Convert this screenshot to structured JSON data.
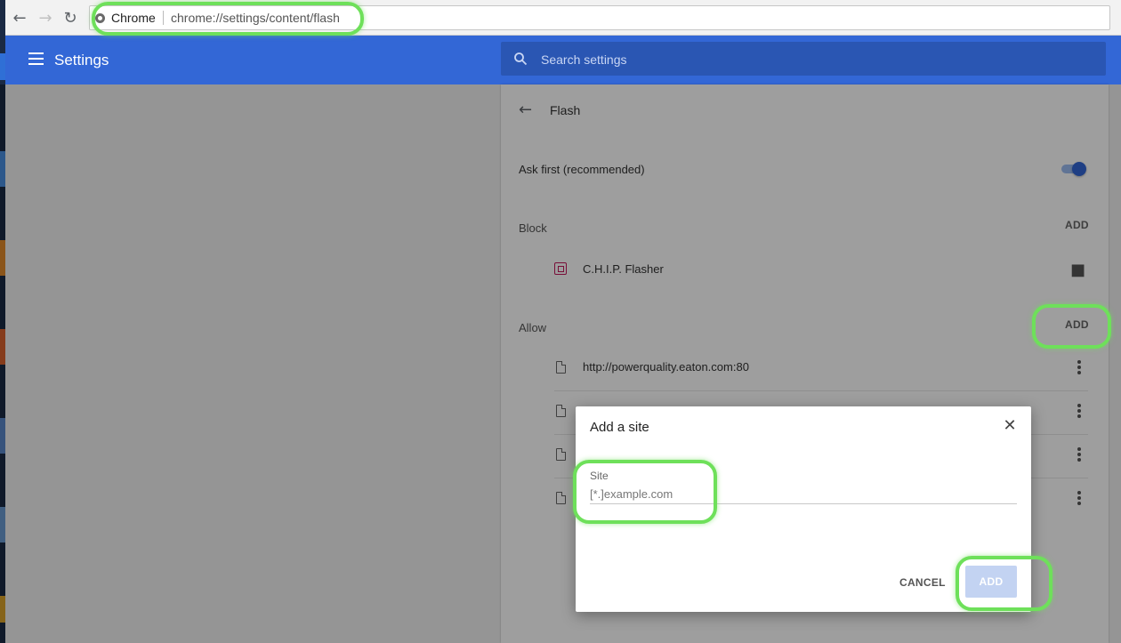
{
  "browser": {
    "omnibox_origin": "Chrome",
    "omnibox_url": "chrome://settings/content/flash"
  },
  "header": {
    "title": "Settings",
    "search_placeholder": "Search settings"
  },
  "page": {
    "title": "Flash",
    "ask_first_label": "Ask first (recommended)",
    "ask_first_enabled": true,
    "block": {
      "label": "Block",
      "add_label": "ADD",
      "items": [
        {
          "name": "C.H.I.P. Flasher",
          "icon": "chip-icon",
          "trailing_icon": "puzzle-icon"
        }
      ]
    },
    "allow": {
      "label": "Allow",
      "add_label": "ADD",
      "items": [
        {
          "url": "http://powerquality.eaton.com:80"
        },
        {
          "url": ""
        },
        {
          "url": ""
        },
        {
          "url": ""
        }
      ]
    }
  },
  "dialog": {
    "title": "Add a site",
    "field_label": "Site",
    "field_placeholder": "[*.]example.com",
    "field_value": "",
    "cancel_label": "CANCEL",
    "add_label": "ADD"
  },
  "colors": {
    "header": "#3367d6",
    "highlight": "#6ee05a",
    "add_disabled": "#c3d3f2"
  }
}
